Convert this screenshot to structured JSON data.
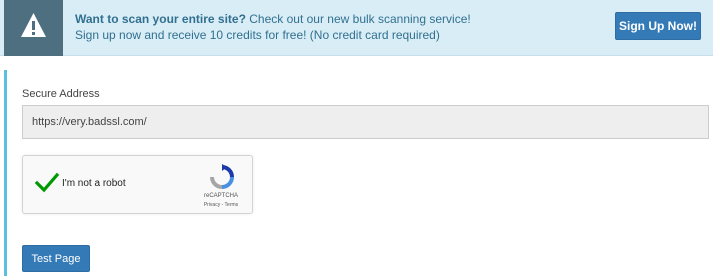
{
  "banner": {
    "headline_bold": "Want to scan your entire site?",
    "headline_rest": " Check out our new bulk scanning service!",
    "subline": "Sign up now and receive 10 credits for free! (No credit card required)",
    "signup_label": "Sign Up Now!",
    "icon": "warning-icon"
  },
  "form": {
    "address_label": "Secure Address",
    "address_value": "https://very.badssl.com/",
    "submit_label": "Test Page"
  },
  "captcha": {
    "label": "I'm not a robot",
    "brand": "reCAPTCHA",
    "links": "Privacy - Terms",
    "checked": true
  },
  "colors": {
    "banner_bg": "#d9edf7",
    "primary": "#337ab7",
    "panel_accent": "#5bc0de",
    "check": "#009900"
  }
}
